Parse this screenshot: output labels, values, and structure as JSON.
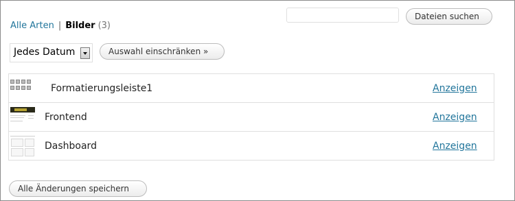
{
  "filters": {
    "all_types": "Alle Arten",
    "separator": "|",
    "images": "Bilder",
    "images_count": "(3)"
  },
  "search": {
    "placeholder": "",
    "value": "",
    "button_label": "Dateien suchen"
  },
  "date_filter": {
    "selected": "Jedes Datum",
    "button_label": "Auswahl einschränken »"
  },
  "media": {
    "rows": [
      {
        "title": "Formatierungsleiste1",
        "action": "Anzeigen",
        "thumbnail": "toolbar-screenshot-thumbnail"
      },
      {
        "title": "Frontend",
        "action": "Anzeigen",
        "thumbnail": "frontend-screenshot-thumbnail"
      },
      {
        "title": "Dashboard",
        "action": "Anzeigen",
        "thumbnail": "dashboard-screenshot-thumbnail"
      }
    ]
  },
  "footer": {
    "save_label": "Alle Änderungen speichern"
  },
  "colors": {
    "link": "#21759b",
    "border": "#dfdfdf"
  }
}
